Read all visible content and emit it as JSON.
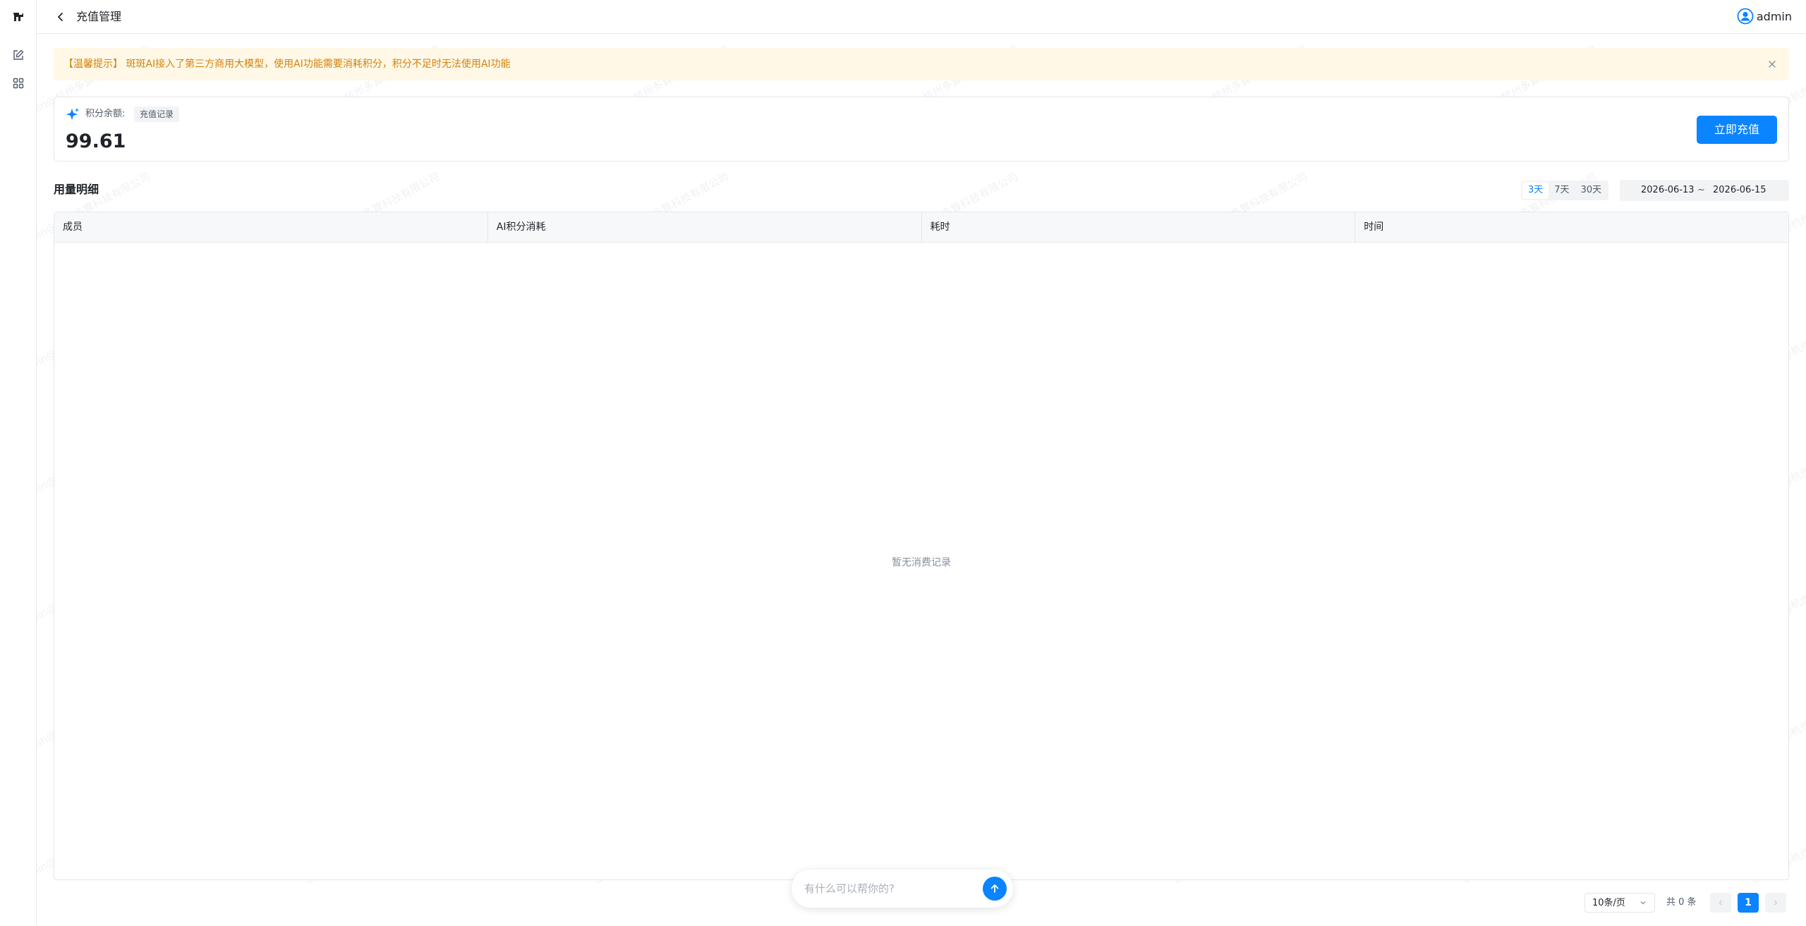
{
  "header": {
    "title": "充值管理",
    "user_name": "admin"
  },
  "notice": {
    "text": "【温馨提示】 斑斑AI接入了第三方商用大模型，使用AI功能需要消耗积分，积分不足时无法使用AI功能"
  },
  "balance": {
    "label": "积分余额:",
    "records_tag": "充值记录",
    "value": "99.61",
    "recharge_button": "立即充值"
  },
  "usage": {
    "title": "用量明细",
    "ranges": [
      {
        "label": "3天",
        "active": true
      },
      {
        "label": "7天",
        "active": false
      },
      {
        "label": "30天",
        "active": false
      }
    ],
    "date_start": "2026-06-13",
    "date_sep": "~",
    "date_end": "2026-06-15"
  },
  "table": {
    "columns": [
      "成员",
      "AI积分消耗",
      "耗时",
      "时间"
    ],
    "empty_text": "暂无消费记录"
  },
  "chat": {
    "placeholder": "有什么可以帮你的?"
  },
  "pagination": {
    "page_size": "10条/页",
    "total": "共 0 条",
    "current_page": "1"
  },
  "watermark_text": "admin@杭州多算科技有限公司",
  "colors": {
    "accent": "#0a84ff",
    "notice_bg": "#fff8e6",
    "notice_text": "#d4820a"
  }
}
